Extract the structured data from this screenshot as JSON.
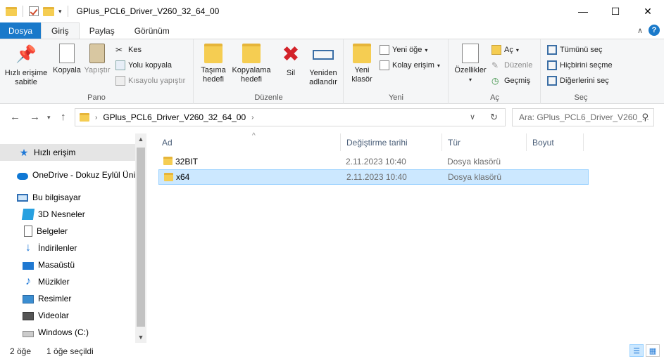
{
  "window": {
    "title": "GPlus_PCL6_Driver_V260_32_64_00",
    "minimize": "—",
    "maximize": "☐",
    "close": "✕"
  },
  "ribbon_tabs": [
    {
      "label": "Dosya"
    },
    {
      "label": "Giriş"
    },
    {
      "label": "Paylaş"
    },
    {
      "label": "Görünüm"
    }
  ],
  "help": "?",
  "collapse": "∧",
  "groups": {
    "pano": {
      "label": "Pano",
      "pin": "Hızlı erişime sabitle",
      "copy": "Kopyala",
      "paste": "Yapıştır",
      "cut": "Kes",
      "copy_path": "Yolu kopyala",
      "paste_shortcut": "Kısayolu yapıştır"
    },
    "duzenle": {
      "label": "Düzenle",
      "move_to": "Taşıma hedefi",
      "copy_to": "Kopyalama hedefi",
      "delete": "Sil",
      "rename": "Yeniden adlandır"
    },
    "yeni": {
      "label": "Yeni",
      "new_folder": "Yeni klasör",
      "new_item": "Yeni öğe",
      "easy_access": "Kolay erişim"
    },
    "ac": {
      "label": "Aç",
      "properties": "Özellikler",
      "open": "Aç",
      "edit": "Düzenle",
      "history": "Geçmiş"
    },
    "sec": {
      "label": "Seç",
      "select_all": "Tümünü seç",
      "select_none": "Hiçbirini seçme",
      "invert": "Diğerlerini seç"
    }
  },
  "address": {
    "path": "GPlus_PCL6_Driver_V260_32_64_00",
    "search_placeholder": "Ara: GPlus_PCL6_Driver_V260_..."
  },
  "navpane": {
    "items": [
      {
        "label": "Hızlı erişim",
        "icon": "star-icon"
      },
      {
        "label": "OneDrive - Dokuz Eylül Üniv",
        "icon": "cloud-icon"
      },
      {
        "label": "Bu bilgisayar",
        "icon": "computer-icon"
      },
      {
        "label": "3D Nesneler",
        "icon": "cube-icon"
      },
      {
        "label": "Belgeler",
        "icon": "documents-icon"
      },
      {
        "label": "İndirilenler",
        "icon": "download-icon"
      },
      {
        "label": "Masaüstü",
        "icon": "desktop-icon"
      },
      {
        "label": "Müzikler",
        "icon": "music-icon"
      },
      {
        "label": "Resimler",
        "icon": "pictures-icon"
      },
      {
        "label": "Videolar",
        "icon": "videos-icon"
      },
      {
        "label": "Windows (C:)",
        "icon": "drive-icon"
      }
    ]
  },
  "columns": {
    "name": "Ad",
    "modified": "Değiştirme tarihi",
    "type": "Tür",
    "size": "Boyut"
  },
  "files": [
    {
      "name": "32BIT",
      "modified": "2.11.2023 10:40",
      "type": "Dosya klasörü",
      "size": ""
    },
    {
      "name": "x64",
      "modified": "2.11.2023 10:40",
      "type": "Dosya klasörü",
      "size": ""
    }
  ],
  "status": {
    "count": "2 öğe",
    "selected": "1 öğe seçildi"
  },
  "colors": {
    "file_tab": "#1979ca",
    "selection": "#cce8ff"
  }
}
